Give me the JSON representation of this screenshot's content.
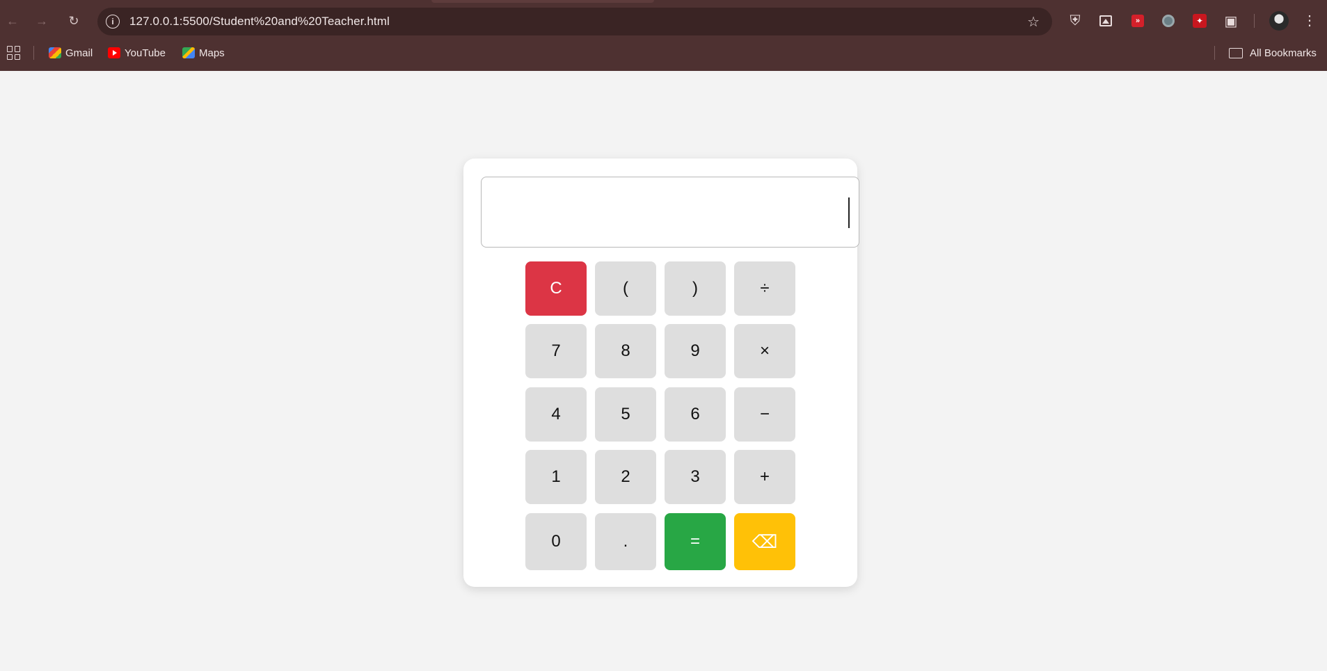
{
  "browser": {
    "url": "127.0.0.1:5500/Student%20and%20Teacher.html",
    "bookmarks": [
      {
        "label": "Gmail",
        "icon": "gmail-icon"
      },
      {
        "label": "YouTube",
        "icon": "youtube-icon"
      },
      {
        "label": "Maps",
        "icon": "maps-icon"
      }
    ],
    "all_bookmarks_label": "All Bookmarks",
    "toolbar_color": "#4e3131"
  },
  "calculator": {
    "display_value": "",
    "keys": [
      {
        "label": "C",
        "name": "clear-button"
      },
      {
        "label": "(",
        "name": "open-paren-button"
      },
      {
        "label": ")",
        "name": "close-paren-button"
      },
      {
        "label": "÷",
        "name": "divide-button"
      },
      {
        "label": "7",
        "name": "digit-7-button"
      },
      {
        "label": "8",
        "name": "digit-8-button"
      },
      {
        "label": "9",
        "name": "digit-9-button"
      },
      {
        "label": "×",
        "name": "multiply-button"
      },
      {
        "label": "4",
        "name": "digit-4-button"
      },
      {
        "label": "5",
        "name": "digit-5-button"
      },
      {
        "label": "6",
        "name": "digit-6-button"
      },
      {
        "label": "−",
        "name": "subtract-button"
      },
      {
        "label": "1",
        "name": "digit-1-button"
      },
      {
        "label": "2",
        "name": "digit-2-button"
      },
      {
        "label": "3",
        "name": "digit-3-button"
      },
      {
        "label": "+",
        "name": "add-button"
      },
      {
        "label": "0",
        "name": "digit-0-button"
      },
      {
        "label": ".",
        "name": "decimal-button"
      },
      {
        "label": "=",
        "name": "equals-button"
      },
      {
        "label": "⌫",
        "name": "backspace-button"
      }
    ],
    "colors": {
      "clear": "#dc3545",
      "equals": "#28a745",
      "backspace": "#ffc107",
      "key": "#dedede"
    }
  }
}
